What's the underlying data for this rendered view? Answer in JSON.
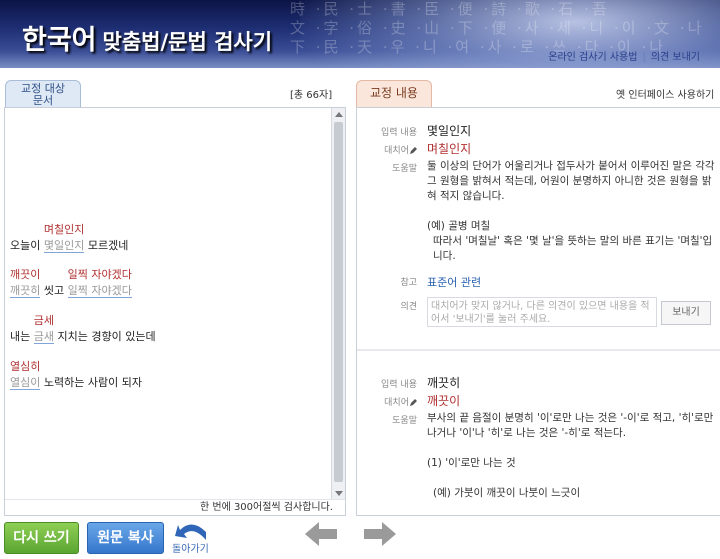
{
  "header": {
    "title_main": "한국어",
    "title_sub": "맞춤법/문법 검사기",
    "bg_text_lines": [
      "時 ·民 ·士 ·書 ·臣 ·便 ·詩 ·歌 ·石 ·吾",
      "文 ·字 ·俗 ·史 ·山 ·下 ·便 ·사 ·세 ·니 ·이 ·文 ·나",
      "下 ·民 ·天 ·우 ·니 ·여 ·사 ·로 ·쓰 ·다 ·이 ·나"
    ],
    "links": {
      "online_usage": "온라인 검사기 사용법",
      "feedback": "의견 보내기"
    }
  },
  "left": {
    "tab_label_1": "교정 대상",
    "tab_label_2": "문서",
    "char_count": "[총 66자]",
    "note": "한 번에 300어절씩 검사합니다.",
    "lines": [
      {
        "pre": "오늘이 ",
        "err": "몇일인지",
        "sugg": "며칠인지",
        "post": " 모르겠네"
      },
      {
        "pre": "",
        "err": "깨끗히",
        "sugg": "깨끗이",
        "mid": " 씻고 ",
        "err2": "일찍 자야겠다",
        "sugg2": "일찍 자야겠다",
        "post": ""
      },
      {
        "pre": "내는 ",
        "err": "금새",
        "sugg": "금세",
        "post": " 지치는 경향이 있는데"
      },
      {
        "pre": "",
        "err": "열심이",
        "sugg": "열심히",
        "post": " 노력하는 사람이 되자"
      }
    ]
  },
  "right": {
    "tab_label": "교정 내용",
    "old_interface": "옛 인터페이스 사용하기",
    "labels": {
      "input": "입력 내용",
      "replace": "대치어",
      "help": "도움말",
      "ref": "참고",
      "opinion": "의견"
    },
    "entries": [
      {
        "input": "몇일인지",
        "replace": "며칠인지",
        "help_main": "둘 이상의 단어가 어울리거나 접두사가 붙어서 이루어진 말은 각각 그 원형을 밝혀서 적는데, 어원이 분명하지 아니한 것은 원형을 밝혀 적지 않습니다.",
        "help_example": "(예) 골병    며칠",
        "help_explain": "따라서 '며칠날' 혹은 '몇 날'을 뜻하는 말의 바른 표기는 '며칠'입니다.",
        "ref_link": "표준어 관련",
        "opinion_placeholder": "대치어가 맞지 않거나, 다른 의견이 있으면 내용을 적어서 '보내기'를 눌러 주세요.",
        "send_label": "보내기"
      },
      {
        "input": "깨끗히",
        "replace": "깨끗이",
        "help_main": "부사의 끝 음절이 분명히 '이'로만 나는 것은 '-이'로 적고, '히'로만 나거나 '이'나 '히'로 나는 것은 '-히'로 적는다.",
        "help_item": "(1) '이'로만 나는 것",
        "help_example": "(예) 가붓이  깨끗이  나붓이  느긋이"
      }
    ]
  },
  "bottom": {
    "rewrite_label": "다시 쓰기",
    "copy_label": "원문 복사",
    "back_label": "돌아가기"
  },
  "colors": {
    "header_dark": "#0c1446",
    "suggestion_red": "#b03030",
    "rewrite_green": "#5aa532",
    "copy_blue": "#3576cc"
  }
}
